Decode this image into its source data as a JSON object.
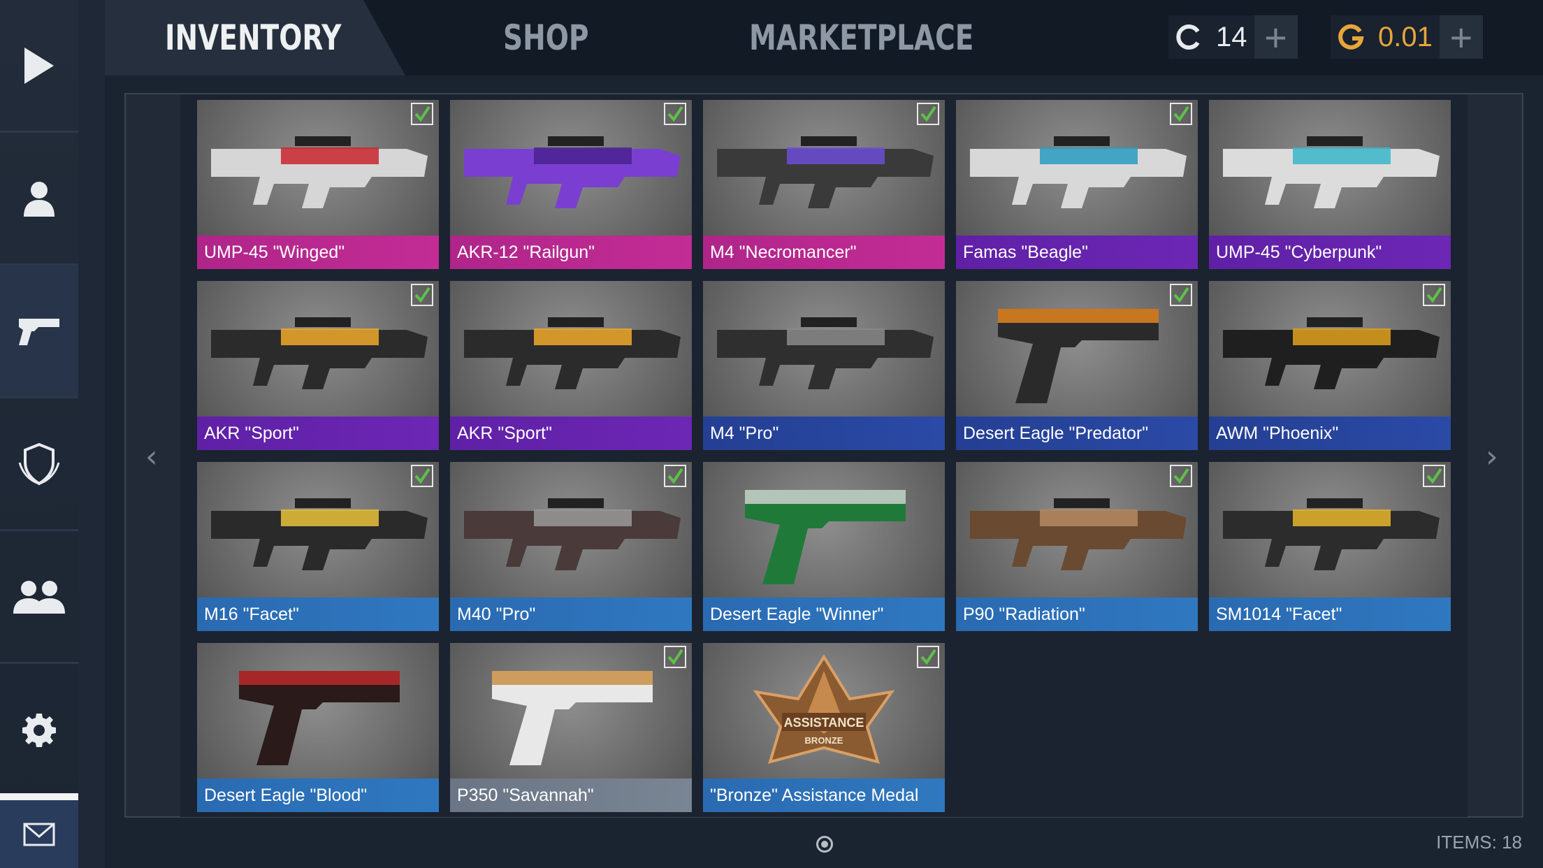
{
  "nav": {
    "tabs": [
      {
        "label": "INVENTORY",
        "active": true
      },
      {
        "label": "SHOP",
        "active": false
      },
      {
        "label": "MARKETPLACE",
        "active": false
      }
    ]
  },
  "currency": {
    "credits": {
      "value": "14",
      "icon": "credits-icon"
    },
    "gold": {
      "value": "0.01",
      "icon": "gold-icon",
      "color": "#e7a63a"
    },
    "plus": "+"
  },
  "sidebar": {
    "items": [
      {
        "name": "play-icon"
      },
      {
        "name": "profile-icon"
      },
      {
        "name": "inventory-gun-icon",
        "active": true
      },
      {
        "name": "clan-shield-icon"
      },
      {
        "name": "friends-icon"
      },
      {
        "name": "settings-icon"
      },
      {
        "name": "mail-icon"
      }
    ]
  },
  "pager": {
    "prev": "‹",
    "next": "›"
  },
  "inventory": {
    "items": [
      {
        "name": "UMP-45 \"Winged\"",
        "rarity": "pink",
        "equipped": true,
        "color": "#b0258a"
      },
      {
        "name": "AKR-12 \"Railgun\"",
        "rarity": "pink",
        "equipped": true,
        "color": "#b0258a"
      },
      {
        "name": "M4 \"Necromancer\"",
        "rarity": "pink",
        "equipped": true,
        "color": "#b0258a"
      },
      {
        "name": "Famas \"Beagle\"",
        "rarity": "purple",
        "equipped": true,
        "color": "#5f20a6"
      },
      {
        "name": "UMP-45 \"Cyberpunk\"",
        "rarity": "purple",
        "equipped": false,
        "color": "#5f20a6"
      },
      {
        "name": "AKR \"Sport\"",
        "rarity": "purple",
        "equipped": true,
        "color": "#5f20a6"
      },
      {
        "name": "AKR \"Sport\"",
        "rarity": "purple",
        "equipped": false,
        "color": "#5f20a6"
      },
      {
        "name": "M4 \"Pro\"",
        "rarity": "blue",
        "equipped": false,
        "color": "#243f93"
      },
      {
        "name": "Desert Eagle \"Predator\"",
        "rarity": "blue",
        "equipped": true,
        "color": "#243f93"
      },
      {
        "name": "AWM \"Phoenix\"",
        "rarity": "blue",
        "equipped": true,
        "color": "#243f93"
      },
      {
        "name": "M16 \"Facet\"",
        "rarity": "lblue",
        "equipped": true,
        "color": "#2a6ab1"
      },
      {
        "name": "M40 \"Pro\"",
        "rarity": "lblue",
        "equipped": true,
        "color": "#2a6ab1"
      },
      {
        "name": "Desert Eagle \"Winner\"",
        "rarity": "lblue",
        "equipped": false,
        "color": "#2a6ab1"
      },
      {
        "name": "P90 \"Radiation\"",
        "rarity": "lblue",
        "equipped": true,
        "color": "#2a6ab1"
      },
      {
        "name": "SM1014 \"Facet\"",
        "rarity": "lblue",
        "equipped": true,
        "color": "#2a6ab1"
      },
      {
        "name": "Desert Eagle \"Blood\"",
        "rarity": "lblue",
        "equipped": false,
        "color": "#2a6ab1"
      },
      {
        "name": "P350 \"Savannah\"",
        "rarity": "grey",
        "equipped": true,
        "color": "#6a7585"
      },
      {
        "name": "\"Bronze\" Assistance Medal",
        "rarity": "medal",
        "equipped": true,
        "color": "#2a6ab1"
      }
    ],
    "count_label": "ITEMS: 18"
  },
  "medal": {
    "line1": "ASSISTANCE",
    "line2": "BRONZE"
  }
}
